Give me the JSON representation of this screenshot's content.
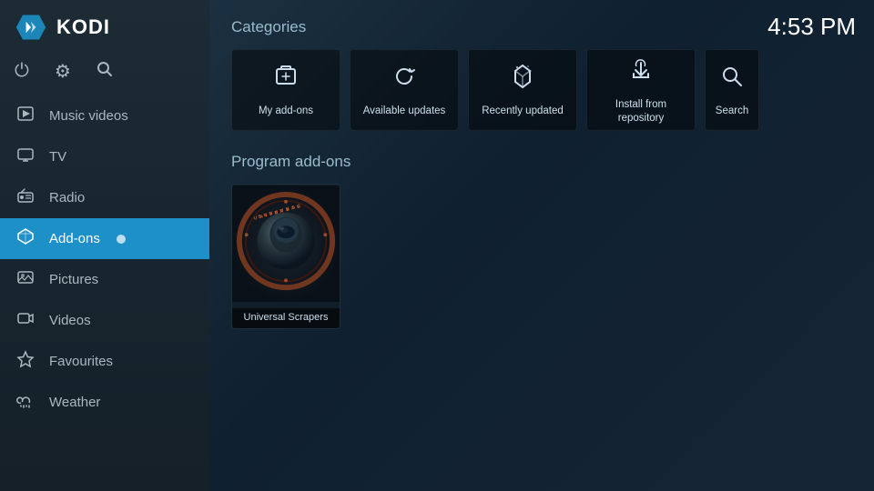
{
  "sidebar": {
    "app_name": "KODI",
    "time": "4:53 PM",
    "nav_items": [
      {
        "id": "music-videos",
        "label": "Music videos",
        "icon": "🎬"
      },
      {
        "id": "tv",
        "label": "TV",
        "icon": "📺"
      },
      {
        "id": "radio",
        "label": "Radio",
        "icon": "📻"
      },
      {
        "id": "addons",
        "label": "Add-ons",
        "icon": "📦",
        "active": true
      },
      {
        "id": "pictures",
        "label": "Pictures",
        "icon": "🖼️"
      },
      {
        "id": "videos",
        "label": "Videos",
        "icon": "🎞️"
      },
      {
        "id": "favourites",
        "label": "Favourites",
        "icon": "⭐"
      },
      {
        "id": "weather",
        "label": "Weather",
        "icon": "🌧️"
      }
    ],
    "top_icons": [
      {
        "id": "power",
        "icon": "⏻"
      },
      {
        "id": "settings",
        "icon": "⚙"
      },
      {
        "id": "search",
        "icon": "🔍"
      }
    ]
  },
  "main": {
    "categories_label": "Categories",
    "program_addons_label": "Program add-ons",
    "categories": [
      {
        "id": "my-addons",
        "label": "My add-ons",
        "icon": "📦"
      },
      {
        "id": "avail-updates",
        "label": "Available updates",
        "icon": "🔄"
      },
      {
        "id": "recently-updated",
        "label": "Recently updated",
        "icon": "📦"
      },
      {
        "id": "install-repo",
        "label": "Install from\nrepository",
        "icon": "📥"
      },
      {
        "id": "search-cat",
        "label": "Search",
        "icon": "🔍"
      }
    ],
    "addons": [
      {
        "id": "universal-scrapers",
        "label": "Universal Scrapers"
      }
    ]
  }
}
